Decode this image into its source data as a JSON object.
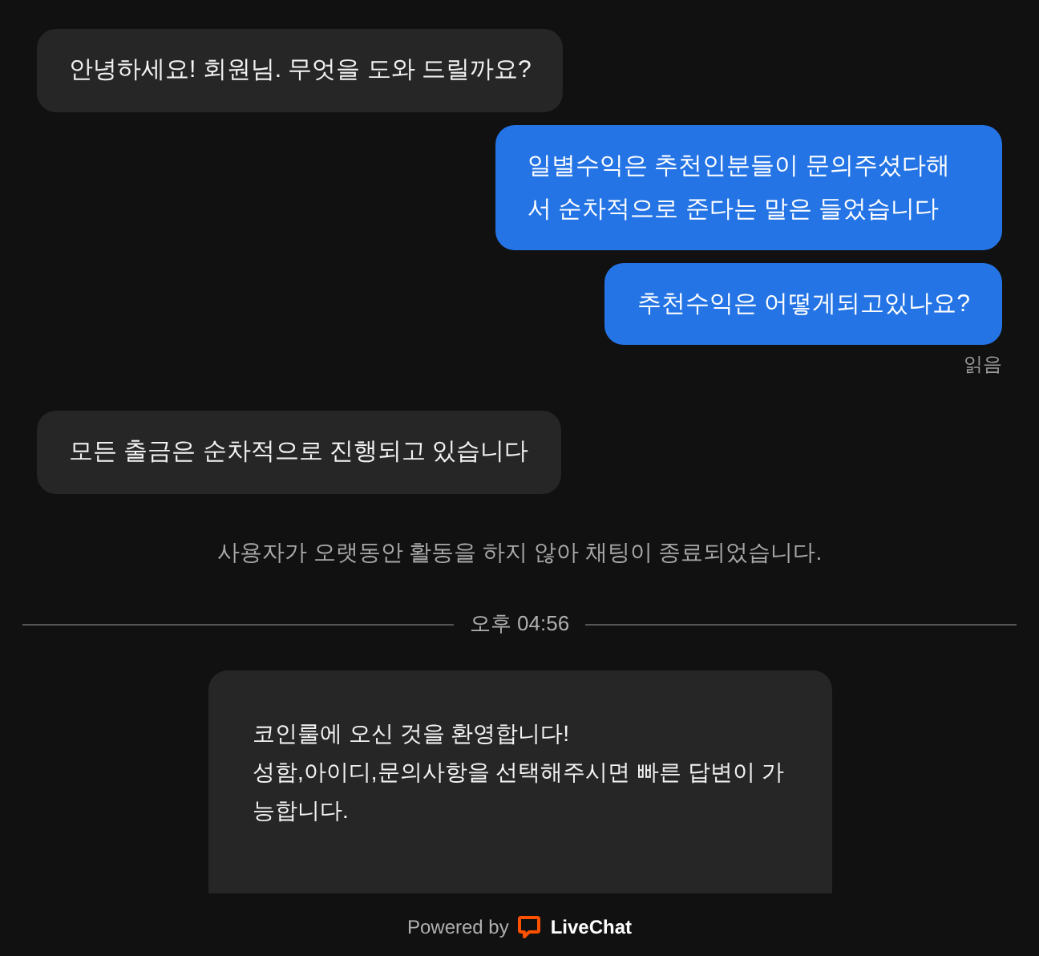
{
  "messages": [
    {
      "kind": "agent",
      "text": "안녕하세요! 회원님. 무엇을 도와 드릴까요?"
    },
    {
      "kind": "user",
      "text": "일별수익은 추천인분들이 문의주셨다해서 순차적으로 준다는 말은 들었습니다"
    },
    {
      "kind": "user",
      "text": "추천수익은 어떻게되고있나요?",
      "receipt": "읽음"
    },
    {
      "kind": "agent",
      "text": "모든 출금은 순차적으로 진행되고 있습니다"
    },
    {
      "kind": "system",
      "text": "사용자가 오랫동안 활동을 하지 않아 채팅이 종료되었습니다."
    },
    {
      "kind": "divider",
      "text": "오후 04:56"
    },
    {
      "kind": "card",
      "text": "코인룰에 오신 것을 환영합니다!\n성함,아이디,문의사항을 선택해주시면 빠른 답변이 가능합니다."
    }
  ],
  "footer": {
    "powered_by": "Powered by",
    "brand": "LiveChat"
  }
}
